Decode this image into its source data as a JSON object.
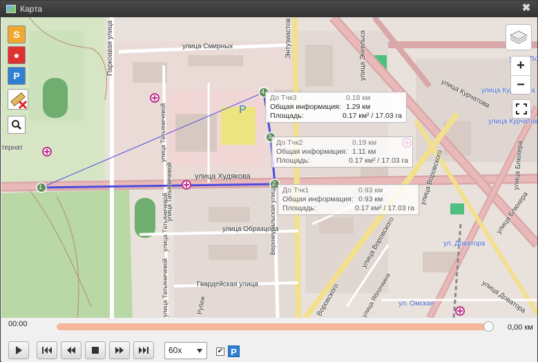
{
  "window": {
    "title": "Карта",
    "close_glyph": "✖"
  },
  "toolbar_left": {
    "tools": [
      {
        "name": "route-tool",
        "icon": "route-s-icon",
        "color": "#f0a830",
        "glyph": "S"
      },
      {
        "name": "poi-tool",
        "icon": "map-pin-icon",
        "color": "#e03030",
        "glyph": "●"
      },
      {
        "name": "parking-tool",
        "icon": "parking-icon",
        "color": "#2f7fd3",
        "glyph": "P"
      }
    ],
    "ruler_icon": "ruler-clear-icon",
    "search_icon": "magnifier-icon"
  },
  "map_controls": {
    "zoom_in": "+",
    "zoom_out": "−",
    "layers_icon": "layers-icon",
    "fullscreen_icon": "fullscreen-icon"
  },
  "streets": {
    "smirnykh": "улица Смирных",
    "engelsa": "улица Энгельса",
    "enthusiastov": "Энтузиастов",
    "kurchatova1": "улица Курчатова",
    "kurchatova2": "улица Курчатова",
    "kurchatova3": "улица Курчатова",
    "voro1": "улица Воро",
    "khudyakova": "улица Худякова",
    "vorovskogo1": "улица Воровского",
    "vorovskogo2": "улица Воровского",
    "vorovskogo3": "Воровского",
    "bluhera1": "улица Блюхера",
    "bluhera2": "улица Блюхера",
    "dovatora1": "ул. Доватора",
    "dovatora2": "улица Доватора",
    "omskaya": "ул. Омская",
    "obrazcova": "улица Образцова",
    "gvardeyskaya": "Гвардейская улица",
    "verkhneuralskaya": "Верхнеуральская улица",
    "tatyanicheva1": "улица Татьяничевой",
    "tatyanicheva2": "улица Татьяничевой",
    "tatyanicheva3": "улица Татьяничевой",
    "tatyanicheva4": "улица Татьяничевой",
    "parkovaya": "Паркоавая улица",
    "internat": "тернат",
    "rubezh": "Рубеж",
    "yablochkina": "улица Яблочкина",
    "parking_label": "P"
  },
  "route_points": [
    {
      "num": "1"
    },
    {
      "num": "2"
    },
    {
      "num": "3"
    },
    {
      "num": "4"
    }
  ],
  "popups": [
    {
      "title": "До Тчк3",
      "title_value": "0.18 км",
      "info_label": "Общая информация:",
      "info_value": "1.29 км",
      "area_label": "Площадь:",
      "area_value": "0.17 км² / 17.03 га"
    },
    {
      "title": "До Тчк2",
      "title_value": "0.19 км",
      "info_label": "Общая информация:",
      "info_value": "1.11 км",
      "area_label": "Площадь:",
      "area_value": "0.17 км² / 17.03 га"
    },
    {
      "title": "До Тчк1",
      "title_value": "0.93 км",
      "info_label": "Общая информация:",
      "info_value": "0.93 км",
      "area_label": "Площадь:",
      "area_value": "0.17 км² / 17.03 га"
    }
  ],
  "playback": {
    "time_start": "00:00",
    "distance": "0,00 км",
    "progress": 1.0,
    "speed": "60x",
    "checkbox_checked": true,
    "checkbox_glyph": "✔",
    "parking_badge": "P",
    "buttons": [
      "play-icon",
      "skip-start-icon",
      "rewind-icon",
      "stop-icon",
      "forward-icon",
      "skip-end-icon"
    ]
  },
  "colors": {
    "route_line": "#4a4adf",
    "route_point": "#5f8f5f",
    "primary_road": "#d4a3a3",
    "park": "#c9e4b5",
    "residential": "#e6d8d2",
    "building": "#d8cbc4",
    "timeline": "#f4b79a"
  }
}
